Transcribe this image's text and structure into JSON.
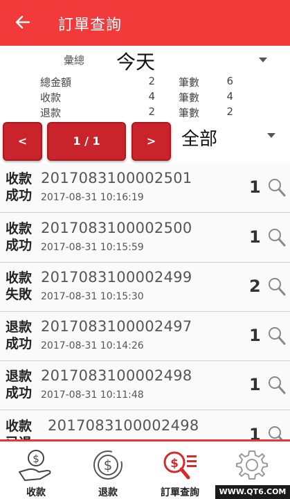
{
  "appbar": {
    "title": "訂單查詢"
  },
  "summary": {
    "total_label": "彙總",
    "period": "今天",
    "rows": [
      {
        "k1": "總金額",
        "v1": "2",
        "k2": "筆數",
        "v2": "6"
      },
      {
        "k1": "收款",
        "v1": "4",
        "k2": "筆數",
        "v2": "4"
      },
      {
        "k1": "退款",
        "v1": "2",
        "k2": "筆數",
        "v2": "2"
      }
    ]
  },
  "pager": {
    "prev": "<",
    "page": "1 / 1",
    "next": ">",
    "filter": "全部"
  },
  "orders": [
    {
      "status": "收款成功",
      "order": "2017083100002501",
      "time": "2017-08-31 10:16:19",
      "count": "1"
    },
    {
      "status": "收款成功",
      "order": "2017083100002500",
      "time": "2017-08-31 10:15:59",
      "count": "1"
    },
    {
      "status": "收款失敗",
      "order": "2017083100002499",
      "time": "2017-08-31 10:15:30",
      "count": "2"
    },
    {
      "status": "退款成功",
      "order": "2017083100002497",
      "time": "2017-08-31 10:14:26",
      "count": "1"
    },
    {
      "status": "退款成功",
      "order": "2017083100002498",
      "time": "2017-08-31 10:11:48",
      "count": "1"
    },
    {
      "status": "收款已退款",
      "order": "2017083100002498",
      "time": "",
      "count": "1"
    }
  ],
  "tabs": [
    {
      "label": "收款",
      "icon": "hand-coin-icon"
    },
    {
      "label": "退款",
      "icon": "refund-dollar-icon"
    },
    {
      "label": "訂單查詢",
      "icon": "order-search-icon"
    },
    {
      "label": "",
      "icon": "gear-icon"
    }
  ],
  "watermark": "WWW.QT6.COM",
  "colors": {
    "primary": "#f23a3a",
    "button": "#c9242c"
  }
}
